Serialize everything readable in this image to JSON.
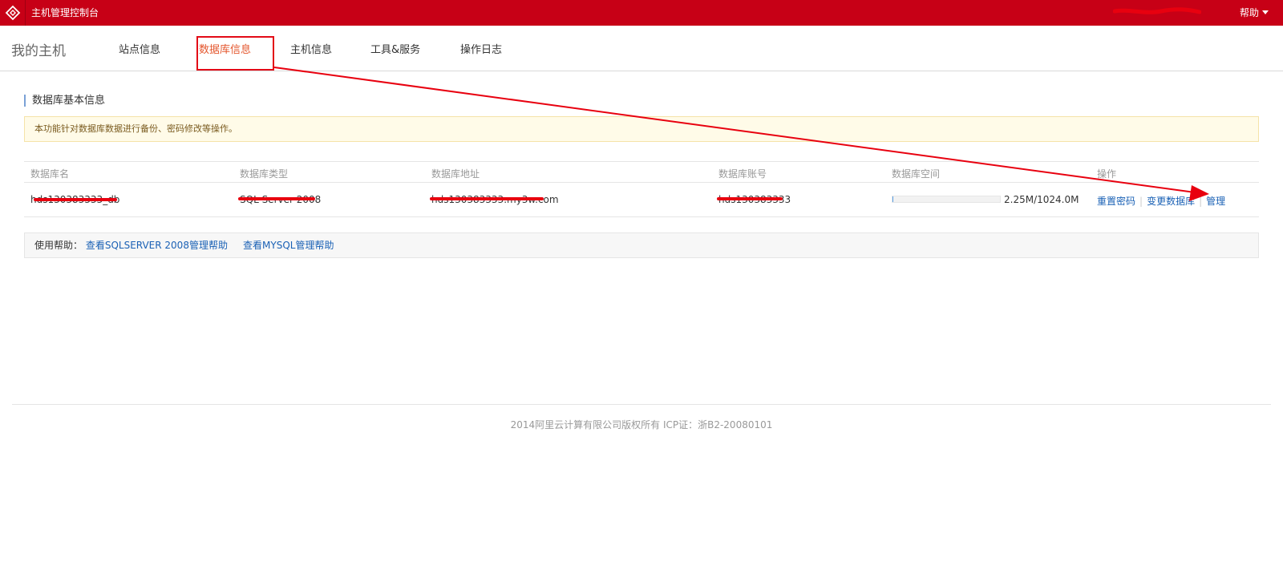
{
  "header": {
    "app_title": "主机管理控制台",
    "help_label": "帮助"
  },
  "nav": {
    "brand": "我的主机",
    "tabs": [
      {
        "label": "站点信息"
      },
      {
        "label": "数据库信息"
      },
      {
        "label": "主机信息"
      },
      {
        "label": "工具&服务"
      },
      {
        "label": "操作日志"
      }
    ]
  },
  "section": {
    "title": "数据库基本信息",
    "notice": "本功能针对数据库数据进行备份、密码修改等操作。"
  },
  "table": {
    "headers": [
      "数据库名",
      "数据库类型",
      "数据库地址",
      "数据库账号",
      "数据库空间",
      "操作"
    ],
    "row": {
      "name": "hds130383333_db",
      "type": "SQL Server 2008",
      "address": "hds130383333.my3w.com",
      "account": "hds130383333",
      "usage_fraction": 0.002,
      "usage_text": "2.25M/1024.0M",
      "actions": [
        "重置密码",
        "变更数据库",
        "管理"
      ]
    }
  },
  "help": {
    "label": "使用帮助：",
    "links": [
      "查看SQLSERVER 2008管理帮助",
      "查看MYSQL管理帮助"
    ]
  },
  "footer": {
    "text": "2014阿里云计算有限公司版权所有 ICP证：浙B2-20080101"
  },
  "colors": {
    "header_bg": "#c70016",
    "annotation_red": "#e8000f",
    "link_blue": "#1a61b5"
  }
}
